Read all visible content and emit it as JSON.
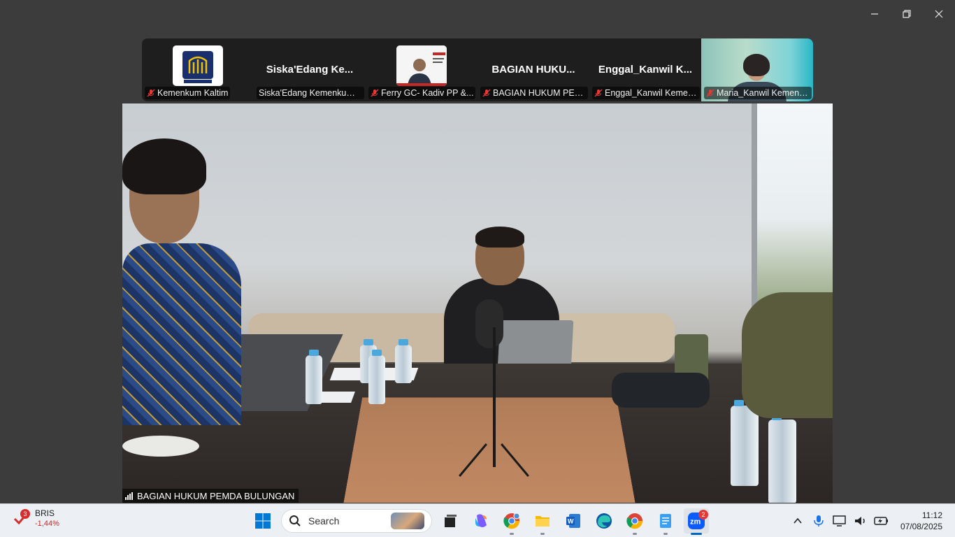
{
  "meeting": {
    "participants": [
      {
        "kind": "logo",
        "label": "Kemenkum Kaltim",
        "muted": true
      },
      {
        "kind": "name",
        "big_name": "Siska'Edang  Ke...",
        "label": "Siska'Edang Kemenkum ...",
        "muted": false
      },
      {
        "kind": "slide",
        "label": "Ferry GC- Kadiv PP &...",
        "muted": true
      },
      {
        "kind": "name",
        "big_name": "BAGIAN HUKU...",
        "label": "BAGIAN HUKUM PEM...",
        "muted": true
      },
      {
        "kind": "name",
        "big_name": "Enggal_Kanwil  K...",
        "label": "Enggal_Kanwil Kemen...",
        "muted": true
      },
      {
        "kind": "video",
        "label": "Maria_Kanwil Kemenk...",
        "muted": true
      }
    ],
    "active_speaker": "BAGIAN HUKUM PEMDA BULUNGAN",
    "logo_text": "PENGAYOMAN"
  },
  "taskbar": {
    "widget": {
      "ticker": "BRIS",
      "change": "-1,44%",
      "badge": "3"
    },
    "search_placeholder": "Search",
    "apps": [
      "task-view",
      "copilot",
      "chrome-profile",
      "file-explorer",
      "word",
      "edge",
      "chrome",
      "notepad",
      "zoom"
    ],
    "zoom_badge": "2",
    "time": "11:12",
    "date": "07/08/2025"
  },
  "colors": {
    "accent": "#0067c0",
    "muted": "#e53935",
    "brand_blue": "#1a2f6e",
    "brand_gold": "#f2c200"
  }
}
